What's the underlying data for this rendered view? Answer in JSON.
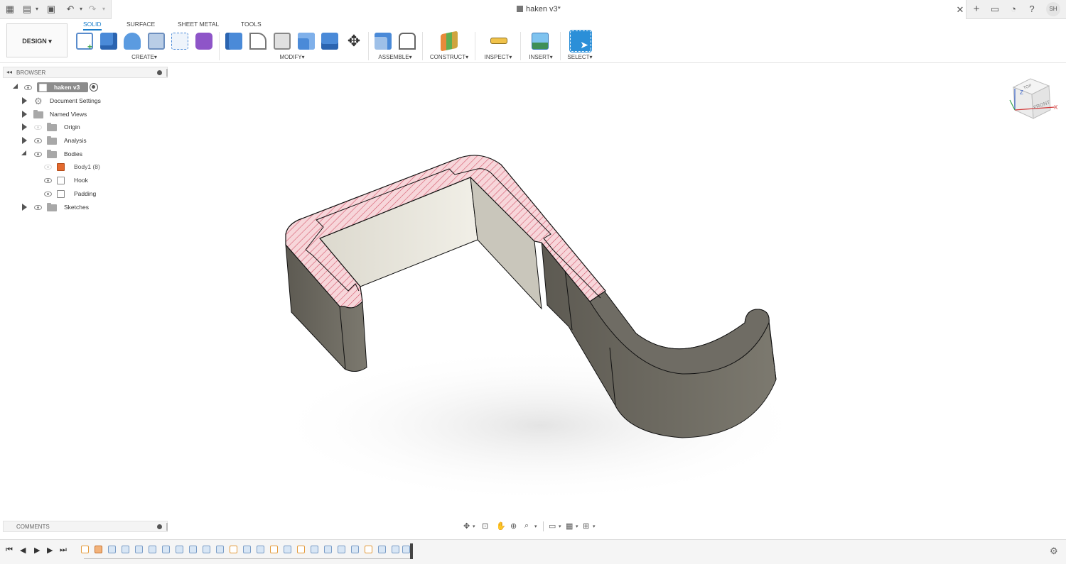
{
  "titlebar": {
    "doc_title": "haken v3*",
    "user_initials": "SH"
  },
  "toolbar": {
    "workspace": "DESIGN",
    "tabs": [
      {
        "label": "SOLID",
        "active": true
      },
      {
        "label": "SURFACE",
        "active": false
      },
      {
        "label": "SHEET METAL",
        "active": false
      },
      {
        "label": "TOOLS",
        "active": false
      }
    ],
    "groups": {
      "create": "CREATE",
      "modify": "MODIFY",
      "assemble": "ASSEMBLE",
      "construct": "CONSTRUCT",
      "inspect": "INSPECT",
      "insert": "INSERT",
      "select": "SELECT"
    },
    "dropdown_glyph": "▾"
  },
  "browser": {
    "header": "BROWSER",
    "root": "haken v3",
    "items": {
      "document_settings": "Document Settings",
      "named_views": "Named Views",
      "origin": "Origin",
      "analysis": "Analysis",
      "bodies": "Bodies",
      "body1": "Body1 (8)",
      "hook": "Hook",
      "padding": "Padding",
      "sketches": "Sketches"
    }
  },
  "comments": {
    "header": "COMMENTS"
  },
  "viewcube": {
    "top": "TOP",
    "front": "FRONT",
    "axis_x": "X",
    "axis_z": "Z"
  },
  "colors": {
    "accent": "#1a7ecb",
    "section_fill": "#f7d6da",
    "section_hatch": "#d4576b",
    "body_dark": "#6e6b63",
    "body_light": "#e8e6dc"
  },
  "icons": {
    "apps": "apps-grid-icon",
    "file": "file-icon",
    "save": "save-icon",
    "undo": "undo-icon",
    "redo": "redo-icon"
  }
}
